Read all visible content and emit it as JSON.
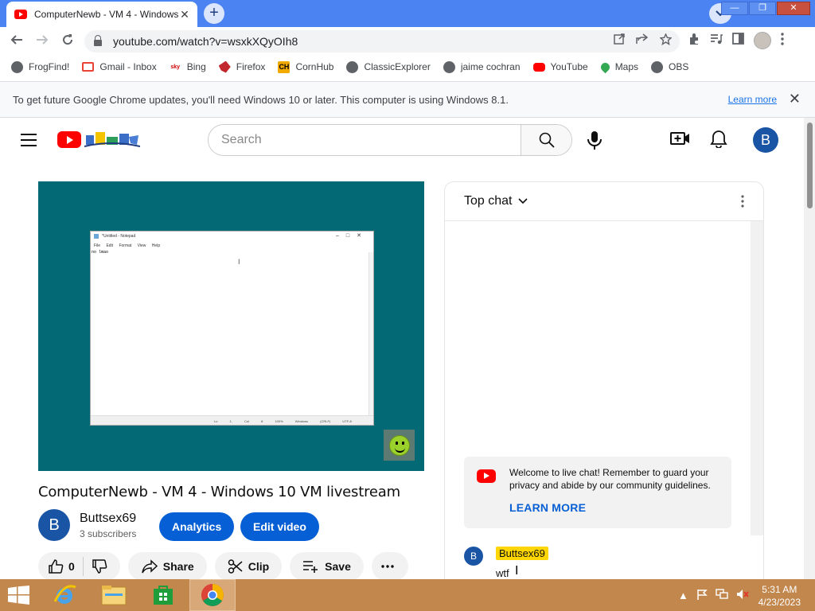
{
  "browser": {
    "tab_title": "ComputerNewb - VM 4 - Windows 10 VM livestream",
    "tab_close": "✕",
    "new_tab": "+",
    "url": "youtube.com/watch?v=wsxkXQyOIh8",
    "window_controls": [
      "—",
      "❐",
      "✕"
    ]
  },
  "bookmarks": [
    {
      "label": "FrogFind!",
      "icon": "globe-icon"
    },
    {
      "label": "Gmail - Inbox",
      "icon": "gmail-icon"
    },
    {
      "label": "Bing",
      "icon": "bing-icon"
    },
    {
      "label": "Firefox",
      "icon": "firefox-icon"
    },
    {
      "label": "CornHub",
      "icon": "cornhub-icon"
    },
    {
      "label": "ClassicExplorer",
      "icon": "globe-icon"
    },
    {
      "label": "jaime cochran",
      "icon": "globe-icon"
    },
    {
      "label": "YouTube",
      "icon": "youtube-icon"
    },
    {
      "label": "Maps",
      "icon": "maps-icon"
    },
    {
      "label": "OBS",
      "icon": "globe-icon"
    }
  ],
  "infobar": {
    "message": "To get future Google Chrome updates, you'll need Windows 10 or later. This computer is using Windows 8.1.",
    "link": "Learn more"
  },
  "masthead": {
    "search_placeholder": "Search",
    "avatar_letter": "B"
  },
  "video": {
    "title": "ComputerNewb - VM 4 - Windows 10 VM livestream",
    "notepad_title": "*Untitled - Notepad",
    "notepad_menu": "File Edit Format View Help",
    "notepad_text": "no lmao",
    "notepad_status": "Ln 1, Col 8 100% Windows (CRLF) UTF-8"
  },
  "owner": {
    "avatar_letter": "B",
    "name": "Buttsex69",
    "subscribers": "3 subscribers",
    "analytics_label": "Analytics",
    "edit_label": "Edit video"
  },
  "actions": {
    "like_count": "0",
    "share_label": "Share",
    "clip_label": "Clip",
    "save_label": "Save"
  },
  "chat": {
    "header": "Top chat",
    "welcome": "Welcome to live chat! Remember to guard your privacy and abide by our community guidelines.",
    "learn_more": "LEARN MORE",
    "messages": [
      {
        "avatar": "B",
        "author": "Buttsex69",
        "text": "wtf"
      }
    ]
  },
  "taskbar": {
    "time": "5:31 AM",
    "date": "4/23/2023"
  },
  "colors": {
    "youtube_red": "#ff0000",
    "chrome_blue": "#4b84f2",
    "button_blue": "#065fd4",
    "player_bg": "#036a75",
    "taskbar": "#c2874d"
  }
}
